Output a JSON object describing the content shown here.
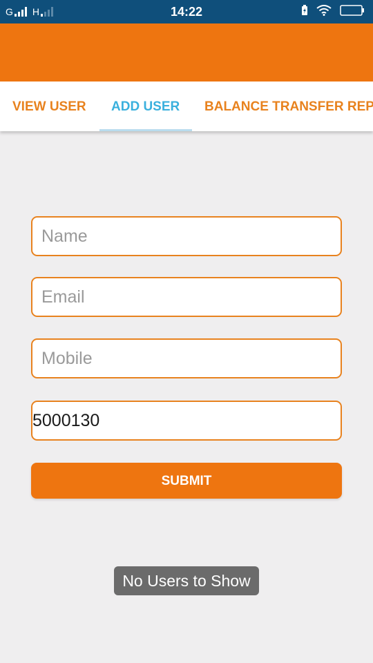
{
  "status_bar": {
    "network_1": "G",
    "network_2": "H",
    "time": "14:22",
    "icons": [
      "signal-icon",
      "battery-charging-icon",
      "wifi-icon",
      "battery-icon"
    ]
  },
  "tabs": [
    {
      "label": "VIEW USER",
      "active": false
    },
    {
      "label": "ADD USER",
      "active": true
    },
    {
      "label": "BALANCE TRANSFER REP",
      "active": false
    }
  ],
  "form": {
    "name_placeholder": "Name",
    "email_placeholder": "Email",
    "mobile_placeholder": "Mobile",
    "amount_value": "5000130",
    "submit_label": "SUBMIT"
  },
  "toast": {
    "message": "No Users to Show"
  },
  "colors": {
    "status_bar": "#0f4f7b",
    "accent": "#ee7510",
    "tab_active": "#3ab0dd",
    "tab_inactive": "#e8821e",
    "background": "#efeeef"
  }
}
